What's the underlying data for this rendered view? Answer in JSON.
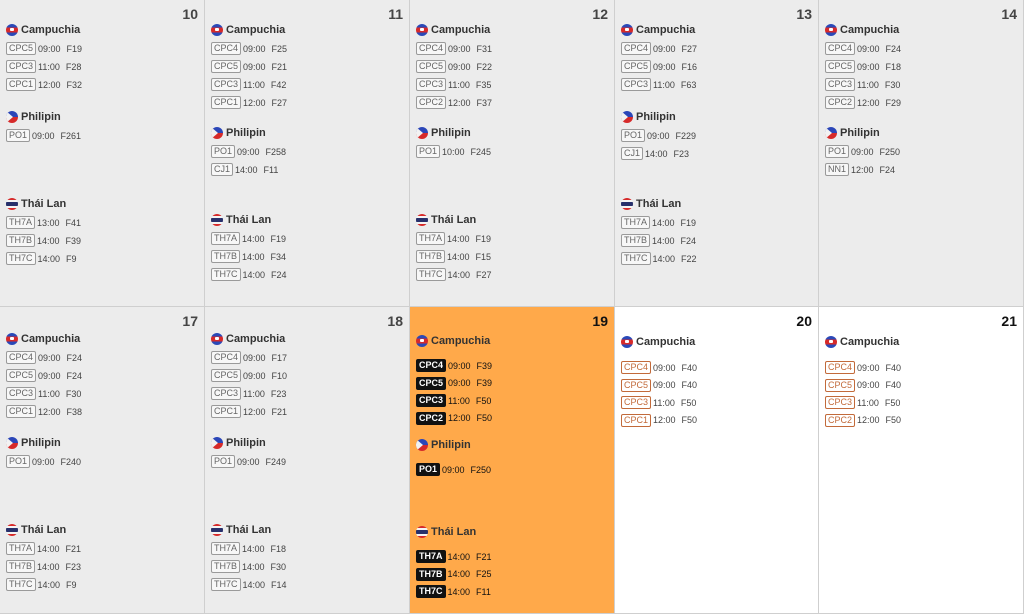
{
  "weeks": [
    {
      "days": [
        {
          "day": "10",
          "state": "past",
          "groups": [
            {
              "country": "Campuchia",
              "flag": "kh",
              "items": [
                {
                  "code": "CPC5",
                  "time": "09:00",
                  "f": "F19"
                },
                {
                  "code": "CPC3",
                  "time": "11:00",
                  "f": "F28"
                },
                {
                  "code": "CPC1",
                  "time": "12:00",
                  "f": "F32"
                }
              ]
            },
            {
              "country": "Philipin",
              "flag": "ph",
              "items": [
                {
                  "code": "PO1",
                  "time": "09:00",
                  "f": "F261"
                }
              ]
            },
            {
              "country": "Thái Lan",
              "flag": "th",
              "items": [
                {
                  "code": "TH7A",
                  "time": "13:00",
                  "f": "F41"
                },
                {
                  "code": "TH7B",
                  "time": "14:00",
                  "f": "F39"
                },
                {
                  "code": "TH7C",
                  "time": "14:00",
                  "f": "F9"
                }
              ]
            }
          ]
        },
        {
          "day": "11",
          "state": "past",
          "groups": [
            {
              "country": "Campuchia",
              "flag": "kh",
              "items": [
                {
                  "code": "CPC4",
                  "time": "09:00",
                  "f": "F25"
                },
                {
                  "code": "CPC5",
                  "time": "09:00",
                  "f": "F21"
                },
                {
                  "code": "CPC3",
                  "time": "11:00",
                  "f": "F42"
                },
                {
                  "code": "CPC1",
                  "time": "12:00",
                  "f": "F27"
                }
              ]
            },
            {
              "country": "Philipin",
              "flag": "ph",
              "items": [
                {
                  "code": "PO1",
                  "time": "09:00",
                  "f": "F258"
                },
                {
                  "code": "CJ1",
                  "time": "14:00",
                  "f": "F11"
                }
              ]
            },
            {
              "country": "Thái Lan",
              "flag": "th",
              "items": [
                {
                  "code": "TH7A",
                  "time": "14:00",
                  "f": "F19"
                },
                {
                  "code": "TH7B",
                  "time": "14:00",
                  "f": "F34"
                },
                {
                  "code": "TH7C",
                  "time": "14:00",
                  "f": "F24"
                }
              ]
            }
          ]
        },
        {
          "day": "12",
          "state": "past",
          "groups": [
            {
              "country": "Campuchia",
              "flag": "kh",
              "items": [
                {
                  "code": "CPC4",
                  "time": "09:00",
                  "f": "F31"
                },
                {
                  "code": "CPC5",
                  "time": "09:00",
                  "f": "F22"
                },
                {
                  "code": "CPC3",
                  "time": "11:00",
                  "f": "F35"
                },
                {
                  "code": "CPC2",
                  "time": "12:00",
                  "f": "F37"
                }
              ]
            },
            {
              "country": "Philipin",
              "flag": "ph",
              "items": [
                {
                  "code": "PO1",
                  "time": "10:00",
                  "f": "F245"
                }
              ]
            },
            {
              "country": "Thái Lan",
              "flag": "th",
              "items": [
                {
                  "code": "TH7A",
                  "time": "14:00",
                  "f": "F19"
                },
                {
                  "code": "TH7B",
                  "time": "14:00",
                  "f": "F15"
                },
                {
                  "code": "TH7C",
                  "time": "14:00",
                  "f": "F27"
                }
              ]
            }
          ]
        },
        {
          "day": "13",
          "state": "past",
          "groups": [
            {
              "country": "Campuchia",
              "flag": "kh",
              "items": [
                {
                  "code": "CPC4",
                  "time": "09:00",
                  "f": "F27"
                },
                {
                  "code": "CPC5",
                  "time": "09:00",
                  "f": "F16"
                },
                {
                  "code": "CPC3",
                  "time": "11:00",
                  "f": "F63"
                }
              ]
            },
            {
              "country": "Philipin",
              "flag": "ph",
              "items": [
                {
                  "code": "PO1",
                  "time": "09:00",
                  "f": "F229"
                },
                {
                  "code": "CJ1",
                  "time": "14:00",
                  "f": "F23"
                }
              ]
            },
            {
              "country": "Thái Lan",
              "flag": "th",
              "items": [
                {
                  "code": "TH7A",
                  "time": "14:00",
                  "f": "F19"
                },
                {
                  "code": "TH7B",
                  "time": "14:00",
                  "f": "F24"
                },
                {
                  "code": "TH7C",
                  "time": "14:00",
                  "f": "F22"
                }
              ]
            }
          ]
        },
        {
          "day": "14",
          "state": "past",
          "groups": [
            {
              "country": "Campuchia",
              "flag": "kh",
              "items": [
                {
                  "code": "CPC4",
                  "time": "09:00",
                  "f": "F24"
                },
                {
                  "code": "CPC5",
                  "time": "09:00",
                  "f": "F18"
                },
                {
                  "code": "CPC3",
                  "time": "11:00",
                  "f": "F30"
                },
                {
                  "code": "CPC2",
                  "time": "12:00",
                  "f": "F29"
                }
              ]
            },
            {
              "country": "Philipin",
              "flag": "ph",
              "items": [
                {
                  "code": "PO1",
                  "time": "09:00",
                  "f": "F250"
                },
                {
                  "code": "NN1",
                  "time": "12:00",
                  "f": "F24"
                }
              ]
            }
          ]
        }
      ]
    },
    {
      "days": [
        {
          "day": "17",
          "state": "past",
          "groups": [
            {
              "country": "Campuchia",
              "flag": "kh",
              "items": [
                {
                  "code": "CPC4",
                  "time": "09:00",
                  "f": "F24"
                },
                {
                  "code": "CPC5",
                  "time": "09:00",
                  "f": "F24"
                },
                {
                  "code": "CPC3",
                  "time": "11:00",
                  "f": "F30"
                },
                {
                  "code": "CPC1",
                  "time": "12:00",
                  "f": "F38"
                }
              ]
            },
            {
              "country": "Philipin",
              "flag": "ph",
              "items": [
                {
                  "code": "PO1",
                  "time": "09:00",
                  "f": "F240"
                }
              ]
            },
            {
              "country": "Thái Lan",
              "flag": "th",
              "items": [
                {
                  "code": "TH7A",
                  "time": "14:00",
                  "f": "F21"
                },
                {
                  "code": "TH7B",
                  "time": "14:00",
                  "f": "F23"
                },
                {
                  "code": "TH7C",
                  "time": "14:00",
                  "f": "F9"
                }
              ]
            }
          ]
        },
        {
          "day": "18",
          "state": "past",
          "groups": [
            {
              "country": "Campuchia",
              "flag": "kh",
              "items": [
                {
                  "code": "CPC4",
                  "time": "09:00",
                  "f": "F17"
                },
                {
                  "code": "CPC5",
                  "time": "09:00",
                  "f": "F10"
                },
                {
                  "code": "CPC3",
                  "time": "11:00",
                  "f": "F23"
                },
                {
                  "code": "CPC1",
                  "time": "12:00",
                  "f": "F21"
                }
              ]
            },
            {
              "country": "Philipin",
              "flag": "ph",
              "items": [
                {
                  "code": "PO1",
                  "time": "09:00",
                  "f": "F249"
                }
              ]
            },
            {
              "country": "Thái Lan",
              "flag": "th",
              "items": [
                {
                  "code": "TH7A",
                  "time": "14:00",
                  "f": "F18"
                },
                {
                  "code": "TH7B",
                  "time": "14:00",
                  "f": "F30"
                },
                {
                  "code": "TH7C",
                  "time": "14:00",
                  "f": "F14"
                }
              ]
            }
          ]
        },
        {
          "day": "19",
          "state": "today",
          "groups": [
            {
              "country": "Campuchia",
              "flag": "kh",
              "items": [
                {
                  "code": "CPC4",
                  "time": "09:00",
                  "f": "F39"
                },
                {
                  "code": "CPC5",
                  "time": "09:00",
                  "f": "F39"
                },
                {
                  "code": "CPC3",
                  "time": "11:00",
                  "f": "F50"
                },
                {
                  "code": "CPC2",
                  "time": "12:00",
                  "f": "F50"
                }
              ]
            },
            {
              "country": "Philipin",
              "flag": "ph",
              "items": [
                {
                  "code": "PO1",
                  "time": "09:00",
                  "f": "F250"
                }
              ]
            },
            {
              "country": "Thái Lan",
              "flag": "th",
              "items": [
                {
                  "code": "TH7A",
                  "time": "14:00",
                  "f": "F21"
                },
                {
                  "code": "TH7B",
                  "time": "14:00",
                  "f": "F25"
                },
                {
                  "code": "TH7C",
                  "time": "14:00",
                  "f": "F11"
                }
              ]
            }
          ]
        },
        {
          "day": "20",
          "state": "future",
          "groups": [
            {
              "country": "Campuchia",
              "flag": "kh",
              "items": [
                {
                  "code": "CPC4",
                  "time": "09:00",
                  "f": "F40"
                },
                {
                  "code": "CPC5",
                  "time": "09:00",
                  "f": "F40"
                },
                {
                  "code": "CPC3",
                  "time": "11:00",
                  "f": "F50"
                },
                {
                  "code": "CPC1",
                  "time": "12:00",
                  "f": "F50"
                }
              ]
            }
          ]
        },
        {
          "day": "21",
          "state": "future",
          "groups": [
            {
              "country": "Campuchia",
              "flag": "kh",
              "items": [
                {
                  "code": "CPC4",
                  "time": "09:00",
                  "f": "F40"
                },
                {
                  "code": "CPC5",
                  "time": "09:00",
                  "f": "F40"
                },
                {
                  "code": "CPC3",
                  "time": "11:00",
                  "f": "F50"
                },
                {
                  "code": "CPC2",
                  "time": "12:00",
                  "f": "F50"
                }
              ]
            }
          ]
        }
      ]
    }
  ]
}
